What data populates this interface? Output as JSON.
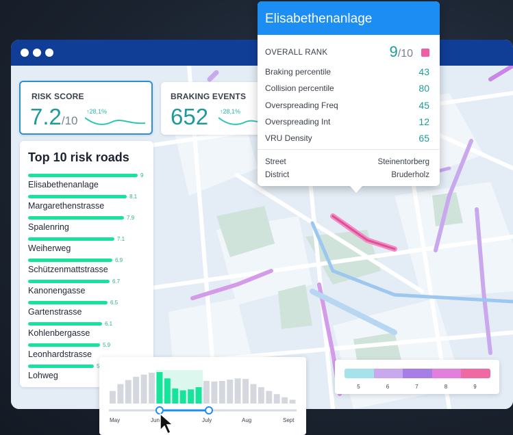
{
  "kpis": [
    {
      "label": "RISK SCORE",
      "value": "7.2",
      "unit": "/10",
      "delta": "↑28,1%"
    },
    {
      "label": "BRAKING EVENTS",
      "value": "652",
      "unit": "",
      "delta": "↑28,1%"
    }
  ],
  "top_roads": {
    "title": "Top 10 risk roads",
    "items": [
      {
        "name": "Elisabethenanlage",
        "score": "9",
        "value": 9
      },
      {
        "name": "Margarethenstrasse",
        "score": "8.1",
        "value": 8.1
      },
      {
        "name": "Spalenring",
        "score": "7.9",
        "value": 7.9
      },
      {
        "name": "Weiherweg",
        "score": "7.1",
        "value": 7.1
      },
      {
        "name": "Schützenmattstrasse",
        "score": "6.9",
        "value": 6.9
      },
      {
        "name": "Kanonengasse",
        "score": "6.7",
        "value": 6.7
      },
      {
        "name": "Gartenstrasse",
        "score": "6.5",
        "value": 6.5
      },
      {
        "name": "Kohlenbergasse",
        "score": "6.1",
        "value": 6.1
      },
      {
        "name": "Leonhardstrasse",
        "score": "5.9",
        "value": 5.9
      },
      {
        "name": "Lohweg",
        "score": "5.4",
        "value": 5.4
      }
    ]
  },
  "popup": {
    "title": "Elisabethenanlage",
    "overall_label": "OVERALL RANK",
    "overall_value": "9",
    "overall_unit": "/10",
    "rows": [
      {
        "label": "Braking percentile",
        "value": "43"
      },
      {
        "label": "Collision percentile",
        "value": "80"
      },
      {
        "label": "Overspreading Freq",
        "value": "45"
      },
      {
        "label": "Overspreading Int",
        "value": "12"
      },
      {
        "label": "VRU Density",
        "value": "65"
      }
    ],
    "info": [
      {
        "label": "Street",
        "value": "Steinentorberg"
      },
      {
        "label": "District",
        "value": "Bruderholz"
      }
    ]
  },
  "timeline": {
    "months": [
      "May",
      "June",
      "July",
      "Aug",
      "Sept"
    ],
    "histogram": [
      0.4,
      0.62,
      0.75,
      0.85,
      0.92,
      0.98,
      1.0,
      0.8,
      0.48,
      0.42,
      0.45,
      0.52,
      0.72,
      0.7,
      0.72,
      0.76,
      0.8,
      0.78,
      0.62,
      0.52,
      0.4,
      0.3,
      0.2,
      0.12
    ],
    "selected_range": [
      "June",
      "July"
    ]
  },
  "legend": {
    "labels": [
      "5",
      "6",
      "7",
      "8",
      "9"
    ],
    "colors": [
      "#a5e2ea",
      "#c9a8ee",
      "#a67ee6",
      "#e27edc",
      "#ee6aa2"
    ]
  },
  "colors": {
    "accent": "#1e9a9c",
    "popup_header": "#1c8df2",
    "titlebar": "#103e96",
    "bar": "#18e39c",
    "rank_swatch": "#ee5ea0"
  }
}
